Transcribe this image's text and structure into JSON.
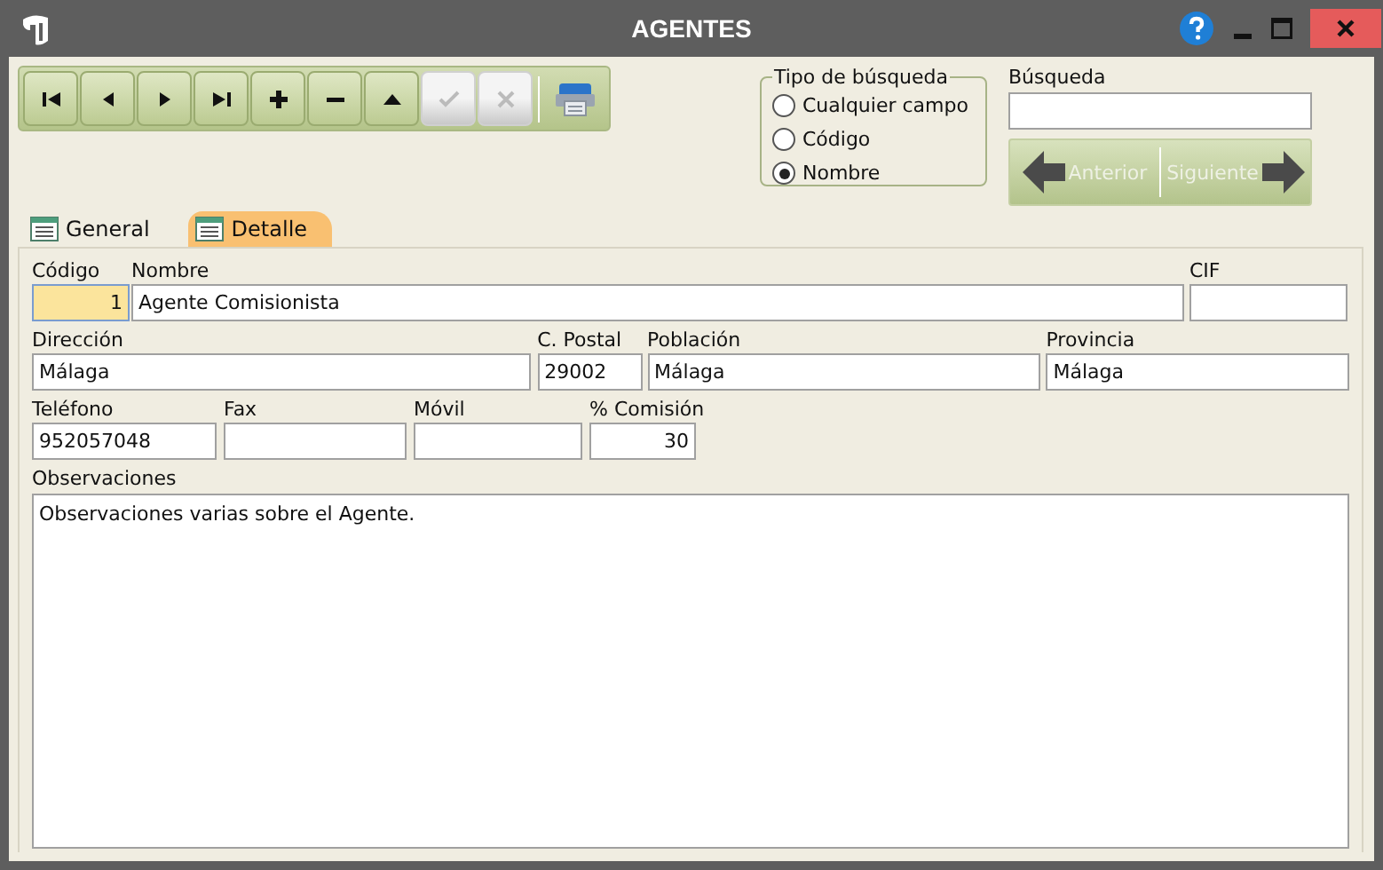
{
  "window": {
    "title": "AGENTES"
  },
  "toolbar": [
    {
      "kind": "first",
      "disabled": false
    },
    {
      "kind": "prev",
      "disabled": false
    },
    {
      "kind": "next",
      "disabled": false
    },
    {
      "kind": "last",
      "disabled": false
    },
    {
      "kind": "add",
      "disabled": false
    },
    {
      "kind": "remove",
      "disabled": false
    },
    {
      "kind": "up",
      "disabled": false
    },
    {
      "kind": "confirm",
      "disabled": true
    },
    {
      "kind": "cancel",
      "disabled": true
    }
  ],
  "search_type": {
    "title": "Tipo de búsqueda",
    "options": [
      {
        "label": "Cualquier campo",
        "selected": false
      },
      {
        "label": "Código",
        "selected": false
      },
      {
        "label": "Nombre",
        "selected": true
      }
    ]
  },
  "search": {
    "label": "Búsqueda",
    "previous": {
      "label": "Anterior",
      "disabled": true
    },
    "next": {
      "label": "Siguiente",
      "disabled": true
    }
  },
  "tabs": [
    {
      "label": "General",
      "selected": false
    },
    {
      "label": "Detalle",
      "selected": true
    }
  ],
  "rows": [
    [
      {
        "label": "Código",
        "value": "1",
        "kind": "number",
        "focused": true
      },
      {
        "label": "Nombre",
        "value": "Agente Comisionista",
        "kind": "text",
        "focused": false
      },
      {
        "label": "CIF",
        "kind": "text",
        "focused": false
      }
    ],
    [
      {
        "label": "Dirección",
        "value": "Málaga",
        "kind": "text",
        "focused": false
      },
      {
        "label": "C. Postal",
        "value": "29002",
        "kind": "text",
        "focused": false
      },
      {
        "label": "Población",
        "value": "Málaga",
        "kind": "text",
        "focused": false
      },
      {
        "label": "Provincia",
        "value": "Málaga",
        "kind": "text",
        "focused": false
      }
    ],
    [
      {
        "label": "Teléfono",
        "value": "952057048",
        "kind": "text",
        "focused": false
      },
      {
        "label": "Fax",
        "kind": "text",
        "focused": false
      },
      {
        "label": "Móvil",
        "kind": "text",
        "focused": false
      },
      {
        "label": "% Comisión",
        "value": "30",
        "kind": "number",
        "focused": false
      }
    ]
  ],
  "notes": {
    "label": "Observaciones",
    "value": "Observaciones varias sobre el Agente."
  }
}
